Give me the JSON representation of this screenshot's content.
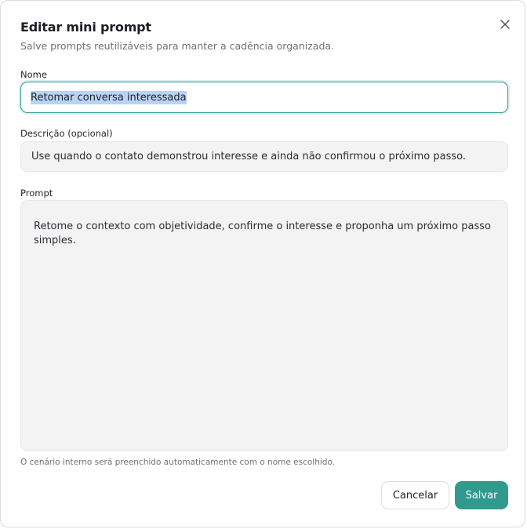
{
  "dialog": {
    "title": "Editar mini prompt",
    "subtitle": "Salve prompts reutilizáveis para manter a cadência organizada.",
    "close_icon": "close-icon"
  },
  "form": {
    "name_label": "Nome",
    "name_value": "Retomar conversa interessada",
    "description_label": "Descrição (opcional)",
    "description_value": "Use quando o contato demonstrou interesse e ainda não confirmou o próximo passo.",
    "prompt_label": "Prompt",
    "prompt_value": "Retome o contexto com objetividade, confirme o interesse e proponha um próximo passo simples.",
    "hint": "O cenário interno será preenchido automaticamente com o nome escolhido."
  },
  "actions": {
    "cancel_label": "Cancelar",
    "save_label": "Salvar"
  },
  "colors": {
    "accent": "#2f9a8d",
    "focus_border": "#3a9e93",
    "field_bg": "#f3f3f4"
  }
}
